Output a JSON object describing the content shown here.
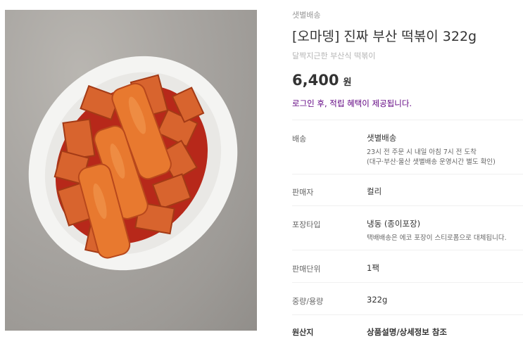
{
  "product": {
    "delivery_tag": "샛별배송",
    "title": "[오마뎅] 진짜 부산 떡볶이 322g",
    "subtitle": "달짝지근한 부산식 떡볶이",
    "price": "6,400",
    "price_unit": "원",
    "login_notice": "로그인 후, 적립 혜택이 제공됩니다."
  },
  "details": [
    {
      "label": "배송",
      "value": "샛별배송",
      "notes": [
        "23시 전 주문 시 내일 아침 7시 전 도착",
        "(대구·부산·울산 샛별배송 운영시간 별도 확인)"
      ]
    },
    {
      "label": "판매자",
      "value": "컬리"
    },
    {
      "label": "포장타입",
      "value": "냉동 (종이포장)",
      "notes": [
        "택배배송은 에코 포장이 스티로폼으로 대체됩니다."
      ]
    },
    {
      "label": "판매단위",
      "value": "1팩"
    },
    {
      "label": "중량/용량",
      "value": "322g"
    },
    {
      "label": "원산지",
      "value": "상품설명/상세정보 참조"
    }
  ]
}
